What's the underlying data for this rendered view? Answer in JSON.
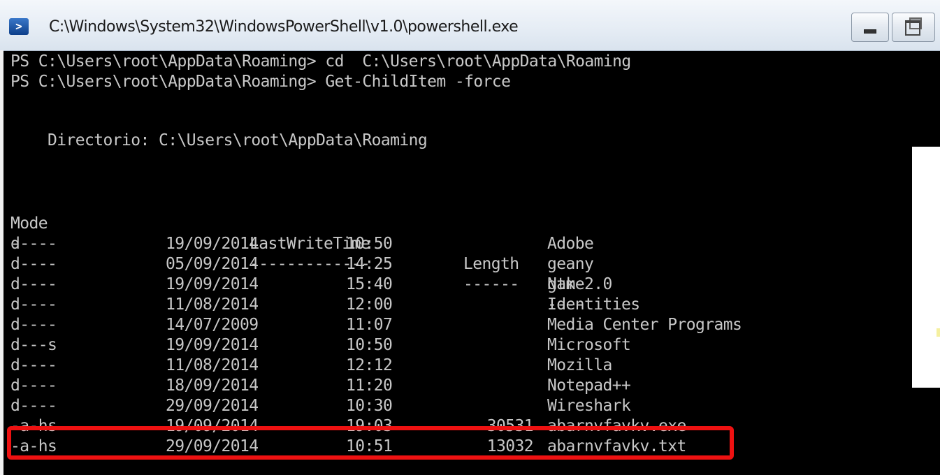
{
  "window": {
    "title": "C:\\Windows\\System32\\WindowsPowerShell\\v1.0\\powershell.exe",
    "icon": "powershell-icon"
  },
  "console": {
    "commands": [
      "PS C:\\Users\\root\\AppData\\Roaming> cd  C:\\Users\\root\\AppData\\Roaming",
      "PS C:\\Users\\root\\AppData\\Roaming> Get-ChildItem -force"
    ],
    "directory_line": "    Directorio: C:\\Users\\root\\AppData\\Roaming",
    "headers": {
      "mode": "Mode",
      "lastwritetime": "LastWriteTime",
      "length": "Length",
      "name": "Name"
    },
    "underlines": {
      "mode": "----",
      "lastwritetime": "-------------",
      "length": "------",
      "name": "----"
    },
    "rows": [
      {
        "mode": "d----",
        "date": "19/09/2014",
        "time": "10:50",
        "length": "",
        "name": "Adobe"
      },
      {
        "mode": "d----",
        "date": "05/09/2014",
        "time": "14:25",
        "length": "",
        "name": "geany"
      },
      {
        "mode": "d----",
        "date": "19/09/2014",
        "time": "15:40",
        "length": "",
        "name": "gtk-2.0"
      },
      {
        "mode": "d----",
        "date": "11/08/2014",
        "time": "12:00",
        "length": "",
        "name": "Identities"
      },
      {
        "mode": "d----",
        "date": "14/07/2009",
        "time": "11:07",
        "length": "",
        "name": "Media Center Programs"
      },
      {
        "mode": "d---s",
        "date": "19/09/2014",
        "time": "10:50",
        "length": "",
        "name": "Microsoft"
      },
      {
        "mode": "d----",
        "date": "11/08/2014",
        "time": "12:12",
        "length": "",
        "name": "Mozilla"
      },
      {
        "mode": "d----",
        "date": "18/09/2014",
        "time": "11:20",
        "length": "",
        "name": "Notepad++"
      },
      {
        "mode": "d----",
        "date": "29/09/2014",
        "time": "10:30",
        "length": "",
        "name": "Wireshark"
      },
      {
        "mode": "-a-hs",
        "date": "19/09/2014",
        "time": "19:03",
        "length": "30531",
        "name": "abarnvfavkv.exe"
      },
      {
        "mode": "-a-hs",
        "date": "29/09/2014",
        "time": "10:51",
        "length": "13032",
        "name": "abarnvfavkv.txt"
      }
    ]
  },
  "colors": {
    "console_bg": "#000000",
    "console_text": "#c8c8c8",
    "highlight": "#ee1111"
  }
}
